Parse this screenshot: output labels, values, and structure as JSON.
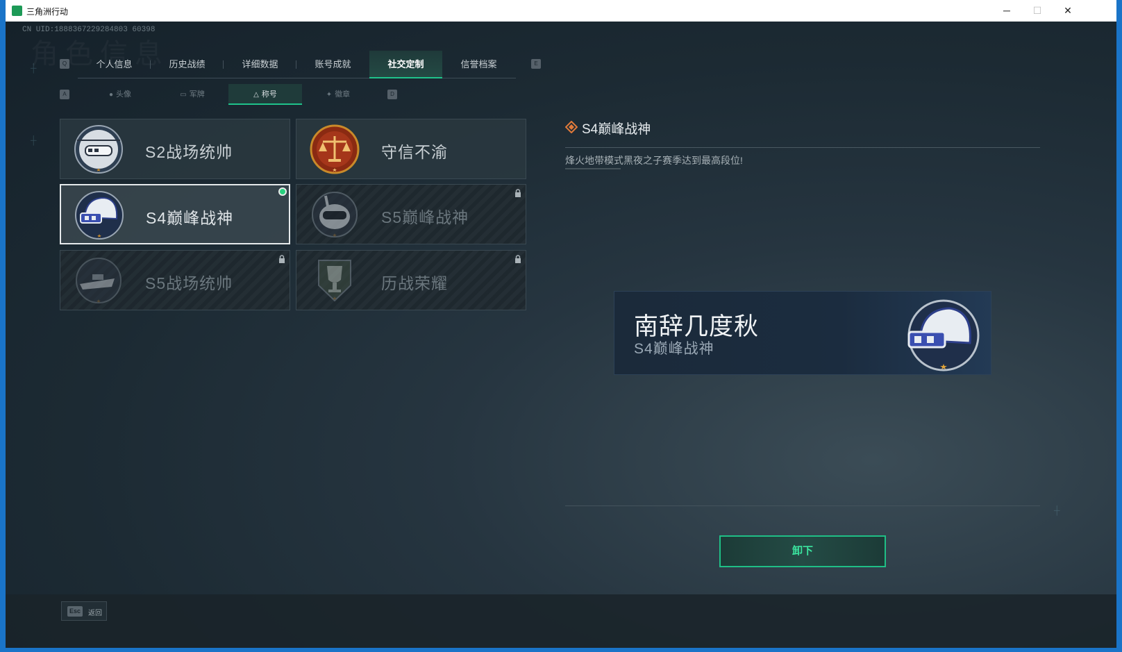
{
  "window": {
    "title": "三角洲行动",
    "minimize": "─",
    "maximize": "☐",
    "close": "✕"
  },
  "header": {
    "uid": "CN UID:1888367229284803 60398",
    "watermark": "角色信息"
  },
  "keys": {
    "left_tab": "Q",
    "right_tab": "E",
    "left_sub": "A",
    "right_sub": "D"
  },
  "tabs": [
    {
      "label": "个人信息"
    },
    {
      "label": "历史战绩"
    },
    {
      "label": "详细数据"
    },
    {
      "label": "账号成就"
    },
    {
      "label": "社交定制"
    },
    {
      "label": "信誉档案"
    }
  ],
  "subtabs": [
    {
      "label": "头像",
      "icon": "person-icon"
    },
    {
      "label": "军牌",
      "icon": "tag-icon"
    },
    {
      "label": "称号",
      "icon": "triangle-icon"
    },
    {
      "label": "徽章",
      "icon": "badge-icon"
    }
  ],
  "titles": [
    {
      "label": "S2战场统帅",
      "state": "unlocked",
      "emblem": "helicopter-emblem"
    },
    {
      "label": "守信不渝",
      "state": "unlocked",
      "emblem": "scales-emblem"
    },
    {
      "label": "S4巅峰战神",
      "state": "equipped",
      "emblem": "night-vision-helmet-emblem"
    },
    {
      "label": "S5巅峰战神",
      "state": "locked",
      "emblem": "diver-mask-emblem"
    },
    {
      "label": "S5战场统帅",
      "state": "locked",
      "emblem": "speedboat-emblem"
    },
    {
      "label": "历战荣耀",
      "state": "locked",
      "emblem": "trophy-emblem"
    }
  ],
  "detail": {
    "title": "S4巅峰战神",
    "description": "烽火地带模式黑夜之子赛季达到最高段位!"
  },
  "preview": {
    "player_name": "南辞几度秋",
    "title": "S4巅峰战神"
  },
  "actions": {
    "unequip": "卸下"
  },
  "footer": {
    "esc_key": "Esc",
    "esc_label": "返回"
  },
  "colors": {
    "accent": "#1fc38b",
    "equipped_dot": "#27d17e",
    "emblem_gold": "#c98a2a"
  }
}
